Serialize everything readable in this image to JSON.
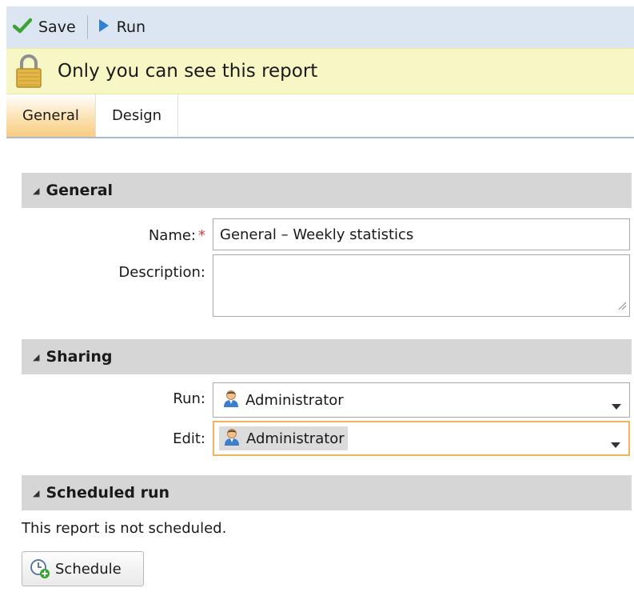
{
  "toolbar": {
    "save_label": "Save",
    "run_label": "Run"
  },
  "info_bar": {
    "message": "Only you can see this report"
  },
  "tabs": [
    {
      "label": "General",
      "active": true
    },
    {
      "label": "Design",
      "active": false
    }
  ],
  "general": {
    "title": "General",
    "name_label": "Name:",
    "required_marker": "*",
    "name_value": "General – Weekly statistics",
    "description_label": "Description:",
    "description_value": ""
  },
  "sharing": {
    "title": "Sharing",
    "run_label": "Run:",
    "run_value": "Administrator",
    "edit_label": "Edit:",
    "edit_value": "Administrator"
  },
  "scheduled": {
    "title": "Scheduled run",
    "status": "This report is not scheduled.",
    "schedule_button": "Schedule"
  },
  "colors": {
    "toolbar_bg": "#dce6f2",
    "info_bar_bg": "#f7f7c6",
    "section_header_bg": "#d6d6d6",
    "active_tab": "#f9cc80",
    "focus_border": "#f0b45a",
    "required": "#d83b3b"
  },
  "icons": {
    "save": "checkmark-icon",
    "run": "play-icon",
    "info": "padlock-icon",
    "user": "user-icon",
    "schedule": "clock-add-icon"
  }
}
